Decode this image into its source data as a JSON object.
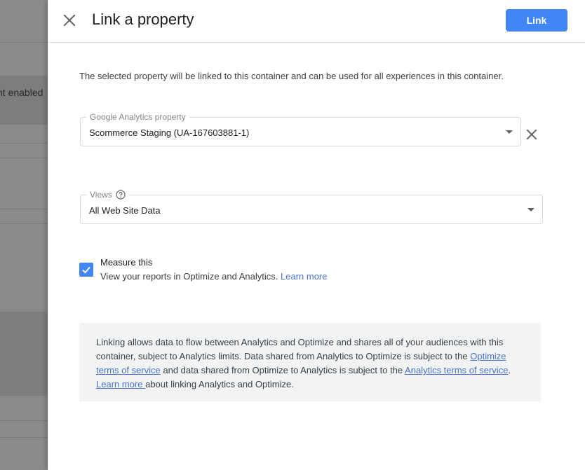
{
  "background": {
    "partial_text": "nt enabled"
  },
  "header": {
    "title": "Link a property",
    "link_button": "Link"
  },
  "intro_text": "The selected property will be linked to this container and can be used for all experiences in this container.",
  "property_field": {
    "label": "Google Analytics property",
    "value": "Scommerce Staging (UA-167603881-1)"
  },
  "views_field": {
    "label": "Views",
    "value": "All Web Site Data"
  },
  "measure": {
    "checked": true,
    "title": "Measure this",
    "subtitle": "View your reports in Optimize and Analytics.",
    "learn_more": "Learn more"
  },
  "info": {
    "text_1": "Linking allows data to flow between Analytics and Optimize and shares all of your audiences with this container, subject to Analytics limits. Data shared from Analytics to Optimize is subject to the ",
    "optimize_terms": "Optimize terms of service",
    "text_2": " and data shared from Optimize to Analytics is subject to the ",
    "analytics_terms": "Analytics terms of service",
    "text_3": ".",
    "learn_more": "Learn more ",
    "text_4": "about linking Analytics and Optimize."
  },
  "colors": {
    "primary": "#4285f4",
    "link": "#4a73c9",
    "info_bg": "#f1f3f4"
  }
}
